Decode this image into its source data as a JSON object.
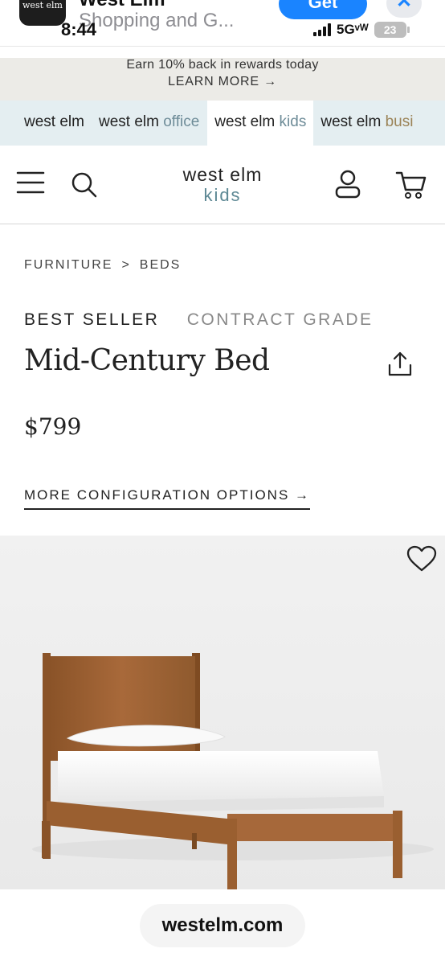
{
  "app_banner": {
    "icon_text": "west elm",
    "title": "West Elm",
    "subtitle": "Shopping and G...",
    "get_label": "Get",
    "close_glyph": "✕"
  },
  "status_bar": {
    "time": "8:44",
    "network": "5Gᵛᵂ",
    "battery": "23"
  },
  "promo": {
    "line1": "Earn 10% back in rewards today",
    "line2": "LEARN MORE →"
  },
  "brand_tabs": [
    {
      "main": "west elm",
      "sub": ""
    },
    {
      "main": "west elm",
      "sub": "office"
    },
    {
      "main": "west elm",
      "sub": "kids"
    },
    {
      "main": "west elm",
      "sub": "busi"
    }
  ],
  "header": {
    "logo_main": "west elm",
    "logo_sub": "kids",
    "icons": [
      "menu-icon",
      "search-icon",
      "account-icon",
      "cart-icon"
    ]
  },
  "product": {
    "breadcrumb": [
      "FURNITURE",
      "BEDS"
    ],
    "breadcrumb_sep": ">",
    "badge_primary": "BEST SELLER",
    "badge_secondary": "CONTRACT GRADE",
    "title": "Mid-Century Bed",
    "price": "$799",
    "more_options": "MORE CONFIGURATION OPTIONS →"
  },
  "browser": {
    "url": "westelm.com"
  },
  "colors": {
    "accent_kids": "#5d8894",
    "accent_business": "#9b8357",
    "brand_tabs_bg": "#e4eef1",
    "promo_bg": "#ecebe7",
    "get_button": "#1a84ff"
  }
}
